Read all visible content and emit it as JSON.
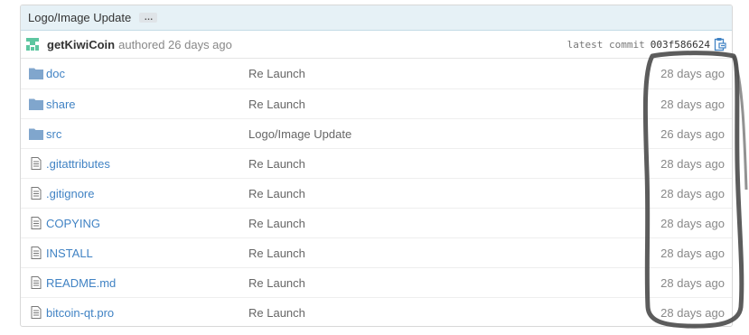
{
  "commit": {
    "title": "Logo/Image Update",
    "ellipsis": "…",
    "author": "getKiwiCoin",
    "authored_text": "authored 26 days ago",
    "latest_label": "latest commit",
    "sha": "003f586624"
  },
  "files": [
    {
      "type": "folder",
      "name": "doc",
      "message": "Re Launch",
      "age": "28 days ago"
    },
    {
      "type": "folder",
      "name": "share",
      "message": "Re Launch",
      "age": "28 days ago"
    },
    {
      "type": "folder",
      "name": "src",
      "message": "Logo/Image Update",
      "age": "26 days ago"
    },
    {
      "type": "file",
      "name": ".gitattributes",
      "message": "Re Launch",
      "age": "28 days ago"
    },
    {
      "type": "file",
      "name": ".gitignore",
      "message": "Re Launch",
      "age": "28 days ago"
    },
    {
      "type": "file",
      "name": "COPYING",
      "message": "Re Launch",
      "age": "28 days ago"
    },
    {
      "type": "file",
      "name": "INSTALL",
      "message": "Re Launch",
      "age": "28 days ago"
    },
    {
      "type": "file",
      "name": "README.md",
      "message": "Re Launch",
      "age": "28 days ago"
    },
    {
      "type": "file",
      "name": "bitcoin-qt.pro",
      "message": "Re Launch",
      "age": "28 days ago"
    }
  ],
  "colors": {
    "link": "#4183c4",
    "folder": "#80a6cd",
    "header_bg": "#e6f1f6",
    "annotation": "#4a4a4a"
  },
  "icons": {
    "folder": "folder-icon",
    "file": "file-text-icon",
    "clipboard": "clipboard-icon",
    "avatar": "identicon-avatar"
  }
}
